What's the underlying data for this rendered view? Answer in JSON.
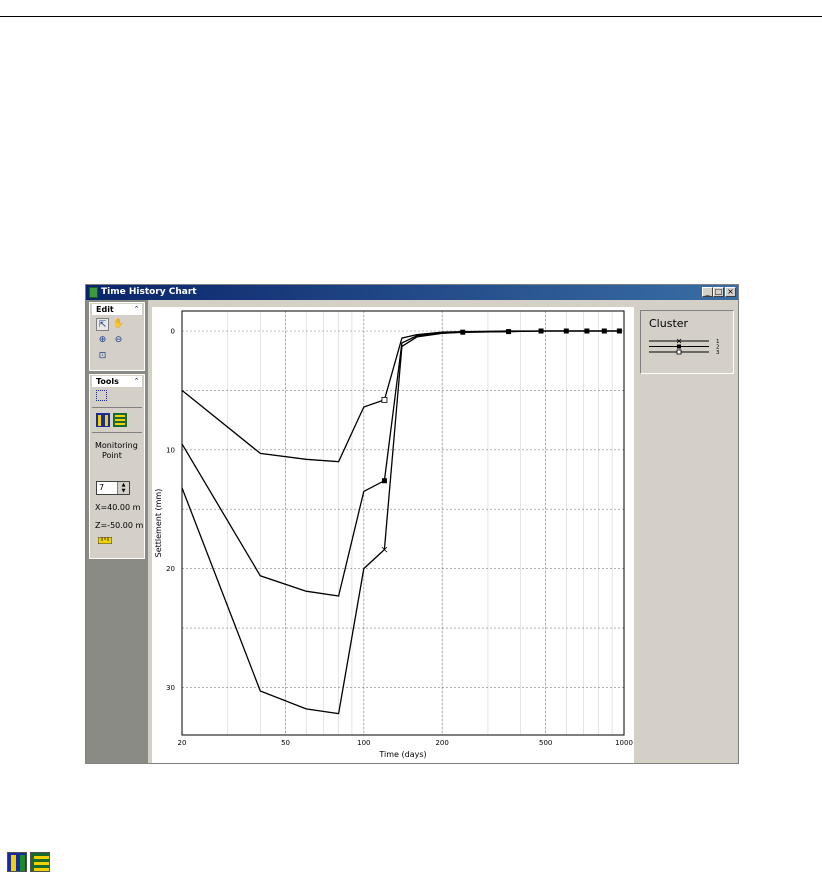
{
  "window": {
    "title": "Time History Chart",
    "minimize_label": "_",
    "maximize_label": "□",
    "close_label": "×"
  },
  "edit_group": {
    "title": "Edit",
    "collapse_glyph": "⌃",
    "tools": [
      {
        "name": "select-arrow-icon",
        "glyph": "⇱"
      },
      {
        "name": "pan-hand-icon",
        "glyph": "✋"
      },
      {
        "name": "zoom-in-icon",
        "glyph": "⊕"
      },
      {
        "name": "zoom-out-icon",
        "glyph": "⊖"
      },
      {
        "name": "zoom-window-icon",
        "glyph": "⊡"
      }
    ]
  },
  "tools_group": {
    "title": "Tools",
    "collapse_glyph": "⌃",
    "monitoring_label_1": "Monitoring",
    "monitoring_label_2": "Point",
    "monitoring_point_value": "7",
    "x_coord": "X=40.00 m",
    "z_coord": "Z=-50.00 m"
  },
  "colors": {
    "line": "#000000",
    "grid": "#808080",
    "titlebar_start": "#0a246a",
    "titlebar_end": "#3a6ea5",
    "icon_yellow": "#f0d000",
    "icon_green": "#1a6a2a",
    "icon_blue": "#1a2a9a"
  },
  "chart_data": {
    "type": "line",
    "xlabel": "Time (days)",
    "ylabel": "Settlement (mm)",
    "xscale": "log",
    "xlim": [
      20,
      1000
    ],
    "ylim": [
      0,
      34
    ],
    "y_inverted": true,
    "x_ticks": [
      20,
      50,
      100,
      200,
      500,
      1000
    ],
    "x_tick_labels": [
      "20",
      "50",
      "100",
      "200",
      "500",
      "1000"
    ],
    "y_ticks": [
      0,
      10,
      20,
      30
    ],
    "y_tick_labels": [
      "0",
      "10",
      "20",
      "30"
    ],
    "grid": true,
    "legend": {
      "title": "Cluster",
      "position": "right"
    },
    "series": [
      {
        "name": "1",
        "marker": "x",
        "x": [
          20,
          40,
          60,
          80,
          100,
          120,
          140,
          160,
          200,
          240,
          360,
          480,
          600,
          720,
          840,
          960
        ],
        "y": [
          13.2,
          30.3,
          31.8,
          32.2,
          20.0,
          18.4,
          1.3,
          0.5,
          0.2,
          0.1,
          0.05,
          0.0,
          0.0,
          0.0,
          0.0,
          0.0
        ],
        "marked_x": [
          120
        ]
      },
      {
        "name": "2",
        "marker": "filled-square",
        "x": [
          20,
          40,
          60,
          80,
          100,
          120,
          140,
          160,
          200,
          240,
          360,
          480,
          600,
          720,
          840,
          960
        ],
        "y": [
          9.5,
          20.6,
          21.9,
          22.3,
          13.5,
          12.6,
          1.0,
          0.4,
          0.15,
          0.1,
          0.05,
          0.0,
          0.0,
          0.0,
          0.0,
          0.0
        ],
        "marked_x": [
          120,
          240,
          360,
          480,
          600,
          720,
          840,
          960
        ]
      },
      {
        "name": "3",
        "marker": "open-square",
        "x": [
          20,
          40,
          60,
          80,
          100,
          120,
          140,
          160,
          200,
          240,
          360,
          480,
          600,
          720,
          840,
          960
        ],
        "y": [
          5.0,
          10.3,
          10.8,
          11.0,
          6.4,
          5.8,
          0.6,
          0.3,
          0.1,
          0.05,
          0.0,
          0.0,
          0.0,
          0.0,
          0.0,
          0.0
        ],
        "marked_x": [
          120
        ]
      }
    ]
  }
}
